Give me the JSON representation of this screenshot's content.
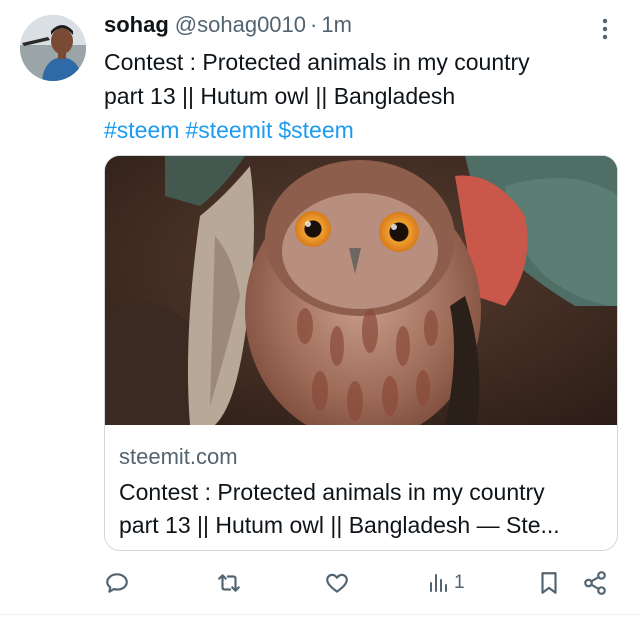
{
  "tweet": {
    "author_name": "sohag",
    "author_handle": "@sohag0010",
    "separator": "·",
    "time": "1m",
    "text_lines": [
      "Contest : Protected animals in my country",
      "part 13 || Hutum owl || Bangladesh"
    ],
    "hashtags": [
      "#steem",
      "#steemit",
      "$steem"
    ]
  },
  "card": {
    "domain": "steemit.com",
    "title_lines": [
      "Contest : Protected animals in my country",
      "part 13 || Hutum owl || Bangladesh — Ste..."
    ]
  },
  "actions": {
    "views": "1",
    "icons": [
      "reply-icon",
      "retweet-icon",
      "like-icon",
      "views-icon",
      "bookmark-icon",
      "share-icon"
    ]
  },
  "colors": {
    "text": "#0f1419",
    "secondary": "#536471",
    "link": "#1d9bf0",
    "border": "#cfd9de"
  }
}
